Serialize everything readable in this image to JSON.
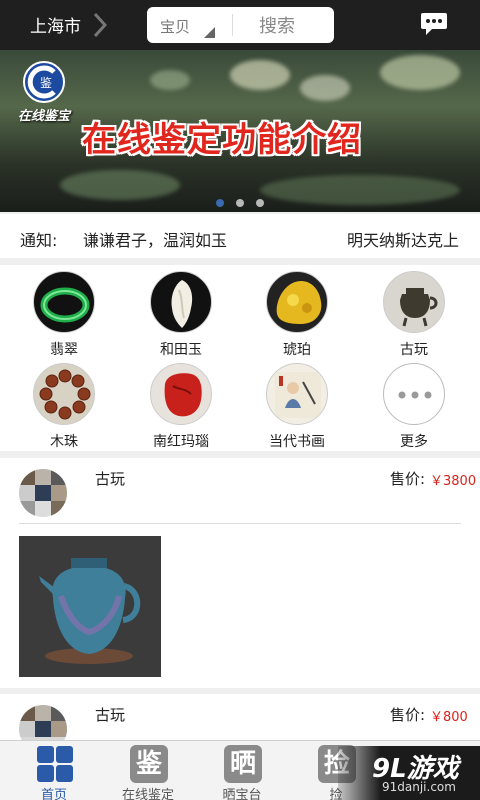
{
  "header": {
    "city": "上海市",
    "search_category": "宝贝",
    "search_button": "搜索"
  },
  "banner": {
    "logo_text": "在线鉴宝",
    "title": "在线鉴定功能介绍",
    "slide_count": 3,
    "active_slide": 1
  },
  "notice": {
    "label": "通知:",
    "text": "谦谦君子，温润如玉",
    "text2": "明天纳斯达克上"
  },
  "categories": [
    {
      "label": "翡翠",
      "icon": "jade-bangle-icon"
    },
    {
      "label": "和田玉",
      "icon": "hetian-jade-icon"
    },
    {
      "label": "琥珀",
      "icon": "amber-icon"
    },
    {
      "label": "古玩",
      "icon": "antique-vessel-icon"
    },
    {
      "label": "木珠",
      "icon": "wood-beads-icon"
    },
    {
      "label": "南红玛瑙",
      "icon": "red-agate-icon"
    },
    {
      "label": "当代书画",
      "icon": "painting-icon"
    },
    {
      "label": "更多",
      "icon": "more-icon"
    }
  ],
  "items": [
    {
      "title": "古玩",
      "price_label": "售价:",
      "price": "￥3800"
    },
    {
      "title": "古玩",
      "price_label": "售价:",
      "price": "￥800"
    }
  ],
  "bottom_nav": [
    {
      "label": "首页",
      "glyph": "",
      "active": true
    },
    {
      "label": "在线鉴定",
      "glyph": "鉴",
      "active": false
    },
    {
      "label": "晒宝台",
      "glyph": "晒",
      "active": false
    },
    {
      "label": "捡",
      "glyph": "捡",
      "active": false
    }
  ],
  "watermark": {
    "big": "9L游戏",
    "small": "91danji.com"
  },
  "colors": {
    "accent": "#2a5aa8",
    "price": "#d9231c",
    "banner_title": "#e0261d",
    "topbar": "#1f1f1f"
  }
}
